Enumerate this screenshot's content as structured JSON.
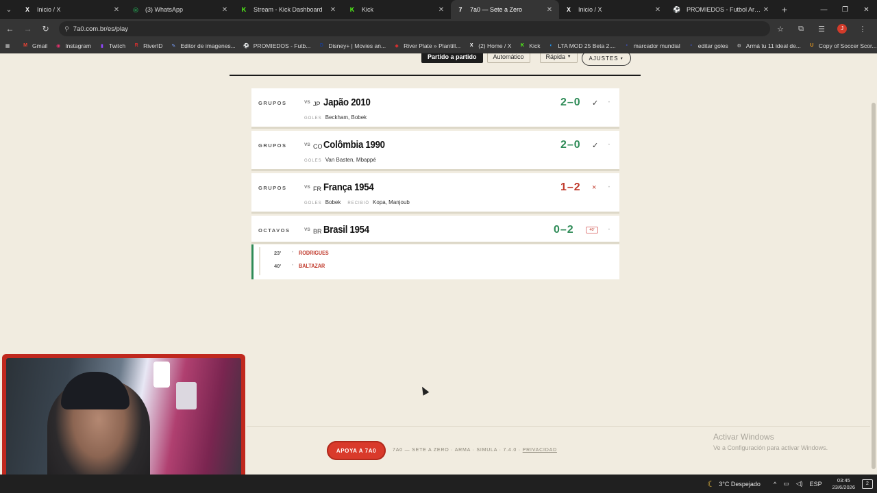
{
  "browser": {
    "tabs": [
      {
        "icon": "x-icon",
        "glyph": "X",
        "label": "Inicio / X",
        "active": false,
        "color": "#ffffff"
      },
      {
        "icon": "whatsapp-icon",
        "glyph": "◎",
        "label": "(3) WhatsApp",
        "active": false,
        "color": "#25d366"
      },
      {
        "icon": "kick-icon",
        "glyph": "K",
        "label": "Stream - Kick Dashboard",
        "active": false,
        "color": "#53fc18"
      },
      {
        "icon": "kick-icon",
        "glyph": "K",
        "label": "Kick",
        "active": false,
        "color": "#53fc18"
      },
      {
        "icon": "7a0-icon",
        "glyph": "7",
        "label": "7a0 — Sete a Zero",
        "active": true,
        "color": "#ffffff"
      },
      {
        "icon": "x-icon",
        "glyph": "X",
        "label": "Inicio / X",
        "active": false,
        "color": "#ffffff"
      },
      {
        "icon": "promiedos-icon",
        "glyph": "⚽",
        "label": "PROMIEDOS - Futbol Argentino",
        "active": false,
        "color": "#5cc060"
      }
    ],
    "url": "7a0.com.br/es/play",
    "bookmarks": [
      {
        "icon": "grid-icon",
        "glyph": "▦",
        "label": "",
        "color": "#cccccc"
      },
      {
        "icon": "gmail-icon",
        "glyph": "M",
        "label": "Gmail",
        "color": "#ea4335"
      },
      {
        "icon": "instagram-icon",
        "glyph": "◉",
        "label": "Instagram",
        "color": "#e1306c"
      },
      {
        "icon": "twitch-icon",
        "glyph": "▮",
        "label": "Twitch",
        "color": "#9146ff"
      },
      {
        "icon": "riverid-icon",
        "glyph": "R",
        "label": "RiverID",
        "color": "#d32f2f"
      },
      {
        "icon": "image-editor-icon",
        "glyph": "✎",
        "label": "Editor de imagenes...",
        "color": "#7aa0ff"
      },
      {
        "icon": "promiedos-icon",
        "glyph": "⚽",
        "label": "PROMIEDOS - Futb...",
        "color": "#5cc060"
      },
      {
        "icon": "disney-icon",
        "glyph": "D",
        "label": "Disney+ | Movies an...",
        "color": "#1a3c8c"
      },
      {
        "icon": "riverplate-icon",
        "glyph": "◆",
        "label": "River Plate » Plantill...",
        "color": "#d32f2f"
      },
      {
        "icon": "x-icon",
        "glyph": "X",
        "label": "(2) Home / X",
        "color": "#ffffff"
      },
      {
        "icon": "kick-icon",
        "glyph": "K",
        "label": "Kick",
        "color": "#53fc18"
      },
      {
        "icon": "lta-icon",
        "glyph": "◐",
        "label": "LTA MOD 25 Beta 2....",
        "color": "#2196f3"
      },
      {
        "icon": "marcador-icon",
        "glyph": "▪",
        "label": "marcador mundial",
        "color": "#3f51b5"
      },
      {
        "icon": "goles-icon",
        "glyph": "▪",
        "label": "editar goles",
        "color": "#3f51b5"
      },
      {
        "icon": "gear-icon",
        "glyph": "⚙",
        "label": "Armá tu 11 ideal de...",
        "color": "#cccccc"
      },
      {
        "icon": "soccer-score-icon",
        "glyph": "U",
        "label": "Copy of Soccer Scor...",
        "color": "#f0a020"
      }
    ]
  },
  "modes": {
    "match_by_match": "Partido a partido",
    "automatic": "Automático",
    "fast": "Rápida",
    "settings": "AJUSTES"
  },
  "matches": [
    {
      "stage": "GRUPOS",
      "vs": "VS",
      "code": "JP",
      "team": "Japão 2010",
      "score": "2–0",
      "result": "win",
      "mark": "✓",
      "goals_label": "GOLES",
      "goals": "Beckham, Bobek",
      "conceded_label": "",
      "conceded": ""
    },
    {
      "stage": "GRUPOS",
      "vs": "VS",
      "code": "CO",
      "team": "Colômbia 1990",
      "score": "2–0",
      "result": "win",
      "mark": "✓",
      "goals_label": "GOLES",
      "goals": "Van Basten, Mbappé",
      "conceded_label": "",
      "conceded": ""
    },
    {
      "stage": "GRUPOS",
      "vs": "VS",
      "code": "FR",
      "team": "França 1954",
      "score": "1–2",
      "result": "loss",
      "mark": "×",
      "goals_label": "GOLES",
      "goals": "Bobek",
      "conceded_label": "RECIBIÓ",
      "conceded": "Kopa, Manjoub"
    },
    {
      "stage": "OCTAVOS",
      "vs": "VS",
      "code": "BR",
      "team": "Brasil 1954",
      "score": "0–2",
      "result": "win",
      "badge": "40'"
    }
  ],
  "events": [
    {
      "minute": "23'",
      "scorer": "RODRIGUES"
    },
    {
      "minute": "40'",
      "scorer": "BALTAZAR"
    }
  ],
  "footer": {
    "support": "APOYA A 7A0",
    "text": "7A0 — SETE A ZERO · ARMA · SIMULA · 7.4.0 ·",
    "privacy": "PRIVACIDAD"
  },
  "windows_watermark": {
    "title": "Activar Windows",
    "subtitle": "Ve a Configuración para activar Windows."
  },
  "taskbar": {
    "weather": "3°C  Despejado",
    "lang": "ESP",
    "time": "03:45",
    "date": "23/6/2026",
    "notifications": "2"
  }
}
